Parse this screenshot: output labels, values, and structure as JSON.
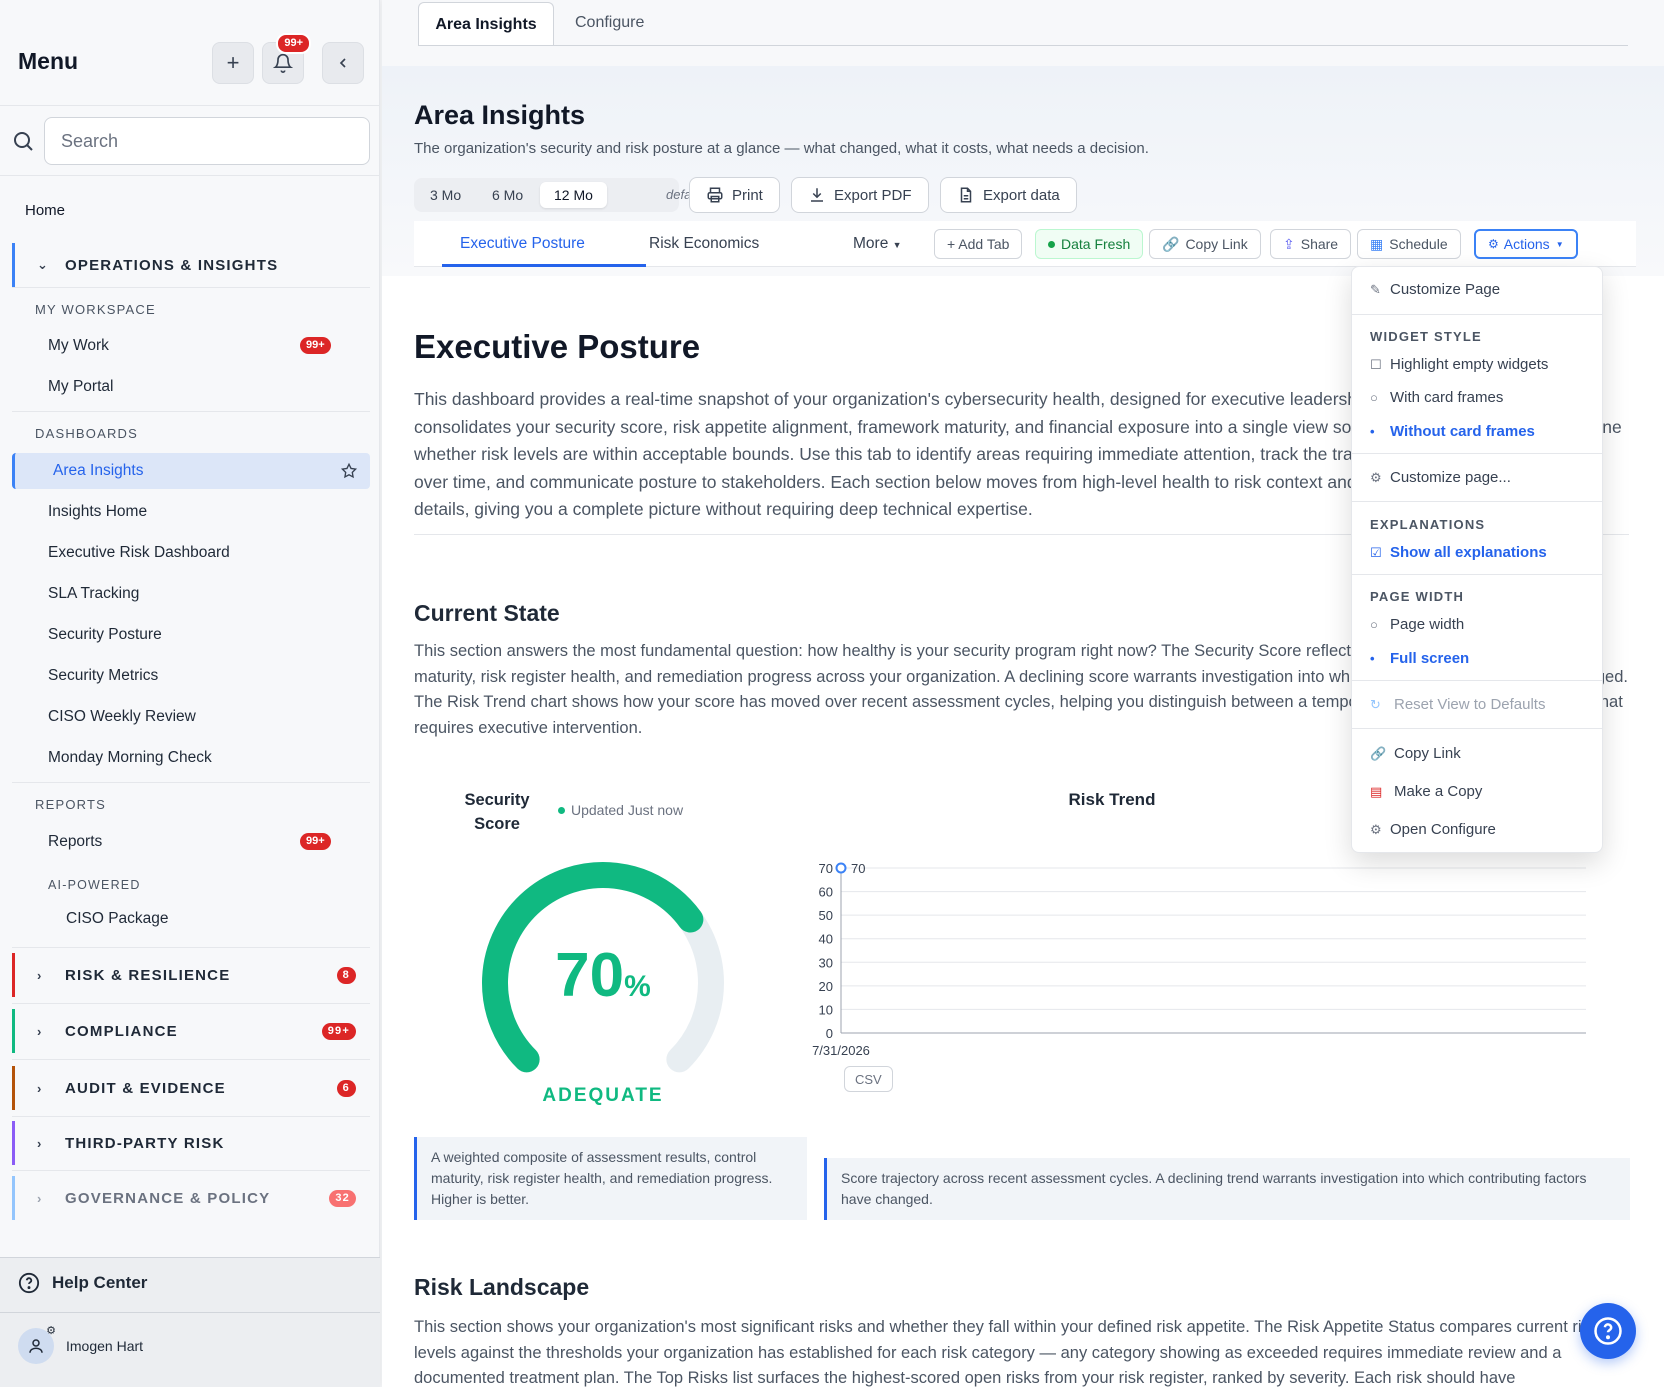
{
  "sidebar": {
    "title": "Menu",
    "notif_count": "99+",
    "search_placeholder": "Search",
    "home": "Home",
    "ops": {
      "label": "OPERATIONS & INSIGHTS",
      "my_workspace": "MY WORKSPACE",
      "my_work": "My Work",
      "my_work_badge": "99+",
      "my_portal": "My Portal",
      "dashboards": "DASHBOARDS",
      "dashboard_items": [
        "Area Insights",
        "Insights Home",
        "Executive Risk Dashboard",
        "SLA Tracking",
        "Security Posture",
        "Security Metrics",
        "CISO Weekly Review",
        "Monday Morning Check"
      ],
      "reports_label": "REPORTS",
      "reports": "Reports",
      "reports_badge": "99+",
      "ai_powered": "AI-POWERED",
      "ciso_package": "CISO Package"
    },
    "sections": [
      {
        "label": "RISK & RESILIENCE",
        "badge": "8",
        "color": "#dc2626"
      },
      {
        "label": "COMPLIANCE",
        "badge": "99+",
        "color": "#10b981"
      },
      {
        "label": "AUDIT & EVIDENCE",
        "badge": "6",
        "color": "#b45309"
      },
      {
        "label": "THIRD-PARTY RISK",
        "badge": "",
        "color": "#8b5cf6"
      },
      {
        "label": "GOVERNANCE & POLICY",
        "badge": "32",
        "color": "#3b82f6"
      }
    ],
    "help_center": "Help Center",
    "user_name": "Imogen Hart"
  },
  "top_tabs": [
    "Area Insights",
    "Configure"
  ],
  "page": {
    "title": "Area Insights",
    "subtitle": "The organization's security and risk posture at a glance — what changed, what it costs, what needs a decision.",
    "ranges": [
      "3 Mo",
      "6 Mo",
      "12 Mo"
    ],
    "range_selected": "12 Mo",
    "default_label": "default",
    "print": "Print",
    "export_pdf": "Export PDF",
    "export_data": "Export data"
  },
  "dash_tabs": {
    "executive": "Executive Posture",
    "risk_econ": "Risk Economics",
    "more": "More",
    "add_tab": "+ Add Tab",
    "data_fresh": "Data Fresh",
    "copy_link": "Copy Link",
    "share": "Share",
    "schedule": "Schedule",
    "actions": "Actions"
  },
  "content": {
    "exec_title": "Executive Posture",
    "exec_text": "This dashboard provides a real-time snapshot of your organization's cybersecurity health, designed for executive leadership and board-level reporting. It consolidates your security score, risk appetite alignment, framework maturity, and financial exposure into a single view so that leaders can quickly determine whether risk levels are within acceptable bounds. Use this tab to identify areas requiring immediate attention, track the trajectory of your security program over time, and communicate posture to stakeholders. Each section below moves from high-level health to risk context and into framework and financial details, giving you a complete picture without requiring deep technical expertise.",
    "current_title": "Current State",
    "current_text": "This section answers the most fundamental question: how healthy is your security program right now? The Security Score reflects assessment results, control maturity, risk register health, and remediation progress across your organization. A declining score warrants investigation into which contributing factors have changed. The Risk Trend chart shows how your score has moved over recent assessment cycles, helping you distinguish between a temporary dip and a sustained decline that requires executive intervention.",
    "gauge_title": "Security Score",
    "updated": "Updated Just now",
    "gauge_value": "70",
    "gauge_unit": "%",
    "gauge_fraction": 0.7,
    "gauge_label": "ADEQUATE",
    "trend_title": "Risk Trend",
    "csv": "CSV",
    "explain_gauge": "A weighted composite of assessment results, control maturity, risk register health, and remediation progress. Higher is better.",
    "explain_trend": "Score trajectory across recent assessment cycles. A declining trend warrants investigation into which contributing factors have changed.",
    "landscape_title": "Risk Landscape",
    "landscape_text": "This section shows your organization's most significant risks and whether they fall within your defined risk appetite. The Risk Appetite Status compares current risk levels against the thresholds your organization has established for each risk category — any category showing as exceeded requires immediate review and a documented treatment plan. The Top Risks list surfaces the highest-scored open risks from your risk register, ranked by severity. Each risk should have"
  },
  "chart_data": {
    "type": "line",
    "title": "Risk Trend",
    "x": [
      "7/31/2026"
    ],
    "series": [
      {
        "values": [
          70
        ]
      }
    ],
    "data_labels": [
      "70"
    ],
    "yticks": [
      "0",
      "10",
      "20",
      "30",
      "40",
      "50",
      "60",
      "70"
    ],
    "ylim": [
      0,
      70
    ],
    "grid": true,
    "line_color": "#3b82f6"
  },
  "actions_menu": {
    "customize_page": "Customize Page",
    "widget_style": "WIDGET STYLE",
    "highlight_empty": "Highlight empty widgets",
    "with_frames": "With card frames",
    "without_frames": "Without card frames",
    "customize_page2": "Customize page...",
    "explanations": "EXPLANATIONS",
    "show_all": "Show all explanations",
    "page_width_label": "PAGE WIDTH",
    "page_width": "Page width",
    "full_screen": "Full screen",
    "reset_view": "Reset View to Defaults",
    "copy_link": "Copy Link",
    "make_copy": "Make a Copy",
    "open_configure": "Open Configure"
  },
  "colors": {
    "accent": "#2563eb",
    "success": "#10b981",
    "danger": "#dc2626"
  }
}
